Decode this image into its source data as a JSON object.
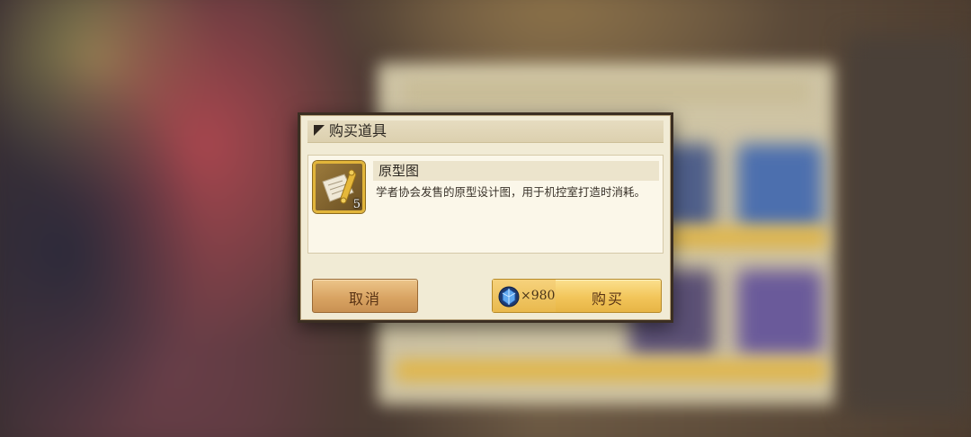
{
  "dialog": {
    "title": "购买道具",
    "item": {
      "name": "原型图",
      "description": "学者协会发售的原型设计图，用于机控室打造时消耗。",
      "quantity": "5",
      "icon": "blueprint-scroll-icon"
    },
    "cancel_label": "取消",
    "buy_label": "购买",
    "price": "×980",
    "currency_icon": "blue-gem-icon"
  },
  "colors": {
    "panel": "#f1ebd5",
    "border": "#3b2e22",
    "cancel_button": "#d9a463",
    "buy_button": "#f2c55a",
    "icon_frame": "#e2b53a"
  }
}
